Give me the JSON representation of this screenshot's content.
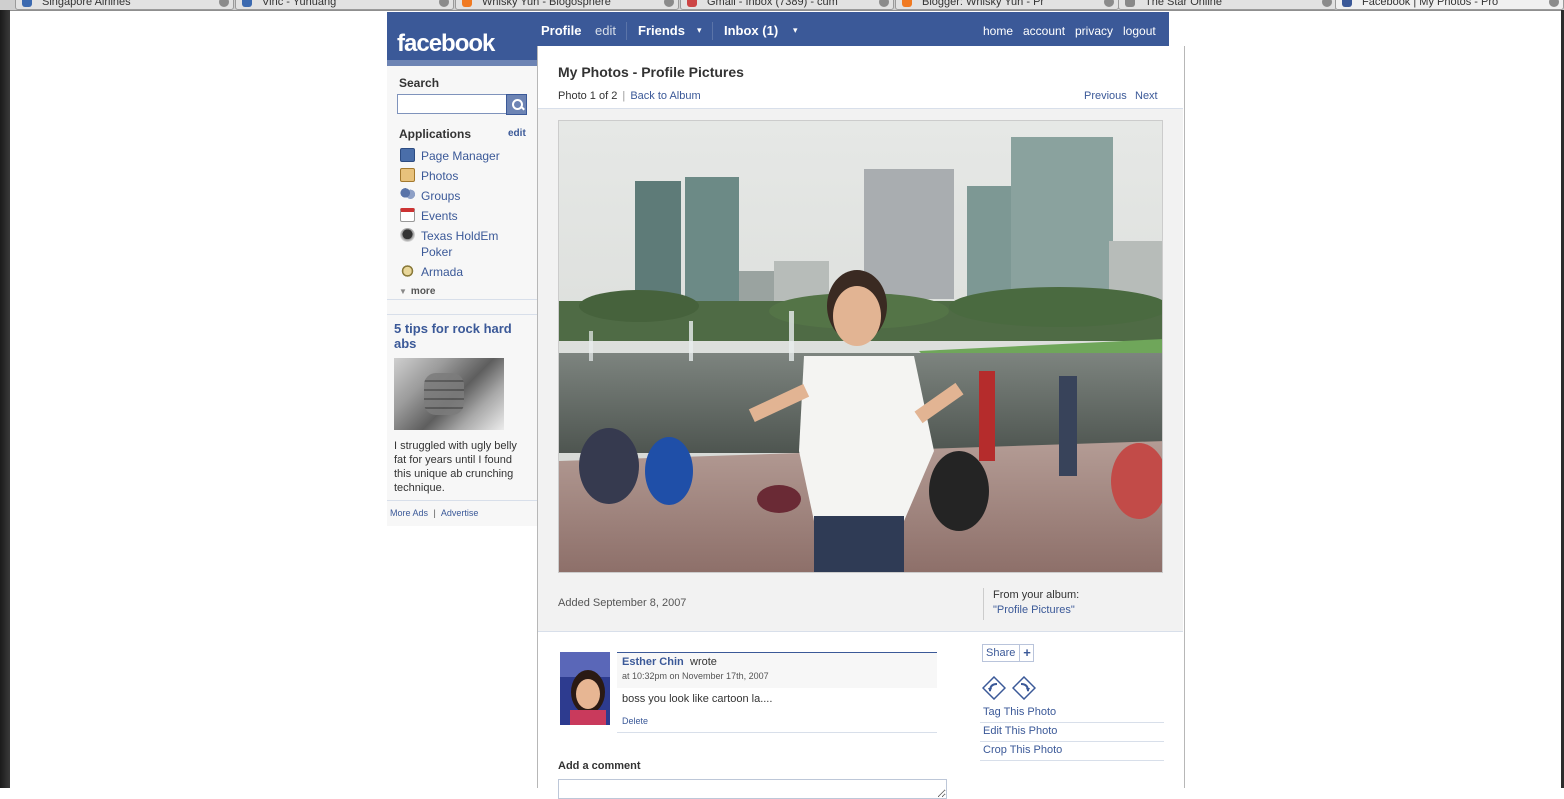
{
  "browser": {
    "tabs": [
      {
        "label": "Singapore Airlines"
      },
      {
        "label": "Vinc - Yuhuang"
      },
      {
        "label": "Whisky Yuh - Blogosphere"
      },
      {
        "label": "Gmail - Inbox (7389) - cum"
      },
      {
        "label": "Blogger: Whisky Yuh - Pr"
      },
      {
        "label": "The Star Online"
      },
      {
        "label": "Facebook | My Photos - Pro"
      }
    ]
  },
  "header": {
    "logo": "facebook",
    "nav": {
      "profile": "Profile",
      "edit": "edit",
      "friends": "Friends",
      "inbox": "Inbox (1)",
      "dropdown_glyph": "▾"
    },
    "right_links": [
      "home",
      "account",
      "privacy",
      "logout"
    ]
  },
  "sidebar": {
    "search_label": "Search",
    "search_value": "",
    "applications_label": "Applications",
    "applications_edit": "edit",
    "apps": [
      {
        "label": "Page Manager",
        "icon": "page-manager-icon",
        "color": "#4a6ea9"
      },
      {
        "label": "Photos",
        "icon": "photos-icon",
        "color": "#d7a55b"
      },
      {
        "label": "Groups",
        "icon": "groups-icon",
        "color": "#5a74a8"
      },
      {
        "label": "Events",
        "icon": "events-icon",
        "color": "#c33"
      },
      {
        "label": "Texas HoldEm Poker",
        "icon": "poker-icon",
        "color": "#444"
      },
      {
        "label": "Armada",
        "icon": "armada-icon",
        "color": "#8a7a3a"
      }
    ],
    "more": "more",
    "ad": {
      "title": "5 tips for rock hard abs",
      "body": "I struggled with ugly belly fat for years until I found this unique ab crunching technique.",
      "more_ads": "More Ads",
      "advertise": "Advertise",
      "divider": "|"
    }
  },
  "main": {
    "title": "My Photos - Profile Pictures",
    "photo_counter": "Photo 1 of 2",
    "counter_sep": "|",
    "back_to_album": "Back to Album",
    "previous": "Previous",
    "next": "Next",
    "added": "Added September 8, 2007",
    "album_from": "From your album:",
    "album_name": "\"Profile Pictures\""
  },
  "comments": [
    {
      "author": "Esther Chin",
      "verb": "wrote",
      "time": "at 10:32pm on November 17th, 2007",
      "text": "boss you look like cartoon la....",
      "delete": "Delete"
    }
  ],
  "add_comment_label": "Add a comment",
  "actions": {
    "share": "Share",
    "share_plus": "+",
    "links": [
      "Tag This Photo",
      "Edit This Photo",
      "Crop This Photo"
    ]
  },
  "colors": {
    "brand": "#3b5998",
    "link": "#3b5998"
  }
}
